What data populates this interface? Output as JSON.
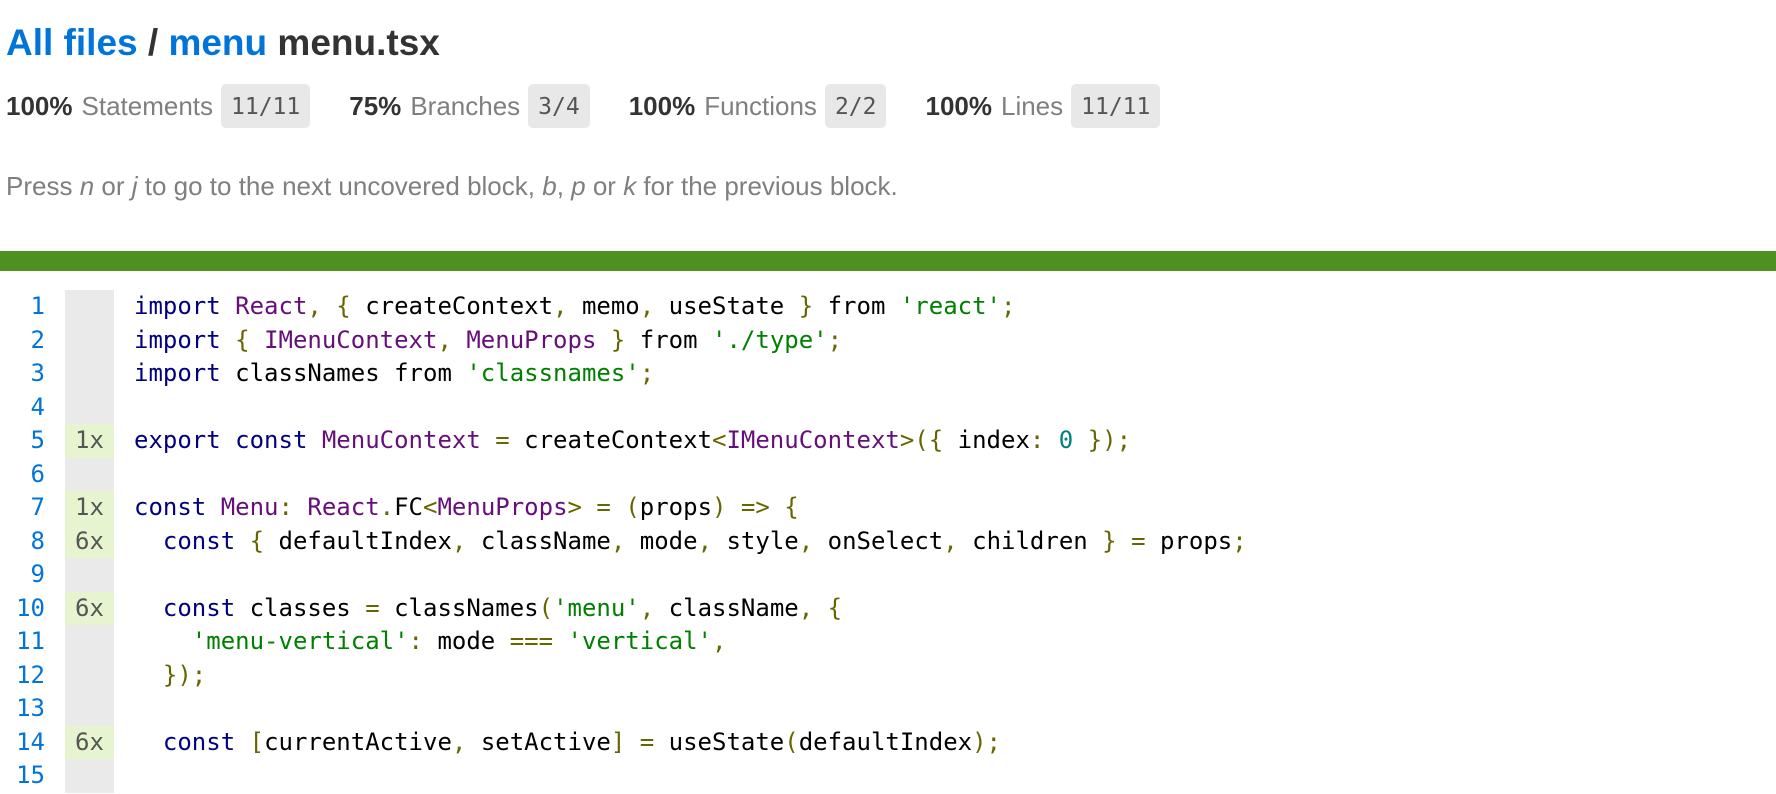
{
  "breadcrumb": {
    "all_files": "All files",
    "separator": "/",
    "folder": "menu",
    "file": "menu.tsx"
  },
  "stats": [
    {
      "pct": "100%",
      "name": "Statements",
      "fraction": "11/11"
    },
    {
      "pct": "75%",
      "name": "Branches",
      "fraction": "3/4"
    },
    {
      "pct": "100%",
      "name": "Functions",
      "fraction": "2/2"
    },
    {
      "pct": "100%",
      "name": "Lines",
      "fraction": "11/11"
    }
  ],
  "hint": {
    "t1": "Press ",
    "k1": "n",
    "t2": " or ",
    "k2": "j",
    "t3": " to go to the next uncovered block, ",
    "k3": "b",
    "t4": ", ",
    "k4": "p",
    "t5": " or ",
    "k5": "k",
    "t6": " for the previous block."
  },
  "colors": {
    "link": "#0074d9",
    "status_bar": "#4d9221",
    "hit_count_bg": "#e6f5d0",
    "gutter_bg": "#eaeaea"
  },
  "code_lines": [
    {
      "num": "1",
      "count": "",
      "tokens": [
        [
          "kw",
          "import "
        ],
        [
          "cls",
          "React"
        ],
        [
          "pn",
          ", { "
        ],
        [
          "",
          "createContext"
        ],
        [
          "pn",
          ", "
        ],
        [
          "",
          "memo"
        ],
        [
          "pn",
          ", "
        ],
        [
          "",
          "useState"
        ],
        [
          "pn",
          " } "
        ],
        [
          "",
          "from "
        ],
        [
          "str",
          "'react'"
        ],
        [
          "pn",
          ";"
        ]
      ]
    },
    {
      "num": "2",
      "count": "",
      "tokens": [
        [
          "kw",
          "import "
        ],
        [
          "pn",
          "{ "
        ],
        [
          "cls",
          "IMenuContext"
        ],
        [
          "pn",
          ", "
        ],
        [
          "cls",
          "MenuProps"
        ],
        [
          "pn",
          " } "
        ],
        [
          "",
          "from "
        ],
        [
          "str",
          "'./type'"
        ],
        [
          "pn",
          ";"
        ]
      ]
    },
    {
      "num": "3",
      "count": "",
      "tokens": [
        [
          "kw",
          "import "
        ],
        [
          "",
          "classNames "
        ],
        [
          "",
          "from "
        ],
        [
          "str",
          "'classnames'"
        ],
        [
          "pn",
          ";"
        ]
      ]
    },
    {
      "num": "4",
      "count": "",
      "tokens": []
    },
    {
      "num": "5",
      "count": "1x",
      "tokens": [
        [
          "kw",
          "export const "
        ],
        [
          "cls",
          "MenuContext"
        ],
        [
          "pn",
          " = "
        ],
        [
          "",
          "createContext"
        ],
        [
          "pn",
          "<"
        ],
        [
          "cls",
          "IMenuContext"
        ],
        [
          "pn",
          ">({ "
        ],
        [
          "",
          "index"
        ],
        [
          "pn",
          ": "
        ],
        [
          "num",
          "0"
        ],
        [
          "pn",
          " });"
        ]
      ]
    },
    {
      "num": "6",
      "count": "",
      "tokens": []
    },
    {
      "num": "7",
      "count": "1x",
      "tokens": [
        [
          "kw",
          "const "
        ],
        [
          "cls",
          "Menu"
        ],
        [
          "pn",
          ": "
        ],
        [
          "cls",
          "React"
        ],
        [
          "pn",
          "."
        ],
        [
          "",
          "FC"
        ],
        [
          "pn",
          "<"
        ],
        [
          "cls",
          "MenuProps"
        ],
        [
          "pn",
          "> = ("
        ],
        [
          "",
          "props"
        ],
        [
          "pn",
          ") => {"
        ]
      ]
    },
    {
      "num": "8",
      "count": "6x",
      "tokens": [
        [
          "",
          "  "
        ],
        [
          "kw",
          "const "
        ],
        [
          "pn",
          "{ "
        ],
        [
          "",
          "defaultIndex"
        ],
        [
          "pn",
          ", "
        ],
        [
          "",
          "className"
        ],
        [
          "pn",
          ", "
        ],
        [
          "",
          "mode"
        ],
        [
          "pn",
          ", "
        ],
        [
          "",
          "style"
        ],
        [
          "pn",
          ", "
        ],
        [
          "",
          "onSelect"
        ],
        [
          "pn",
          ", "
        ],
        [
          "",
          "children"
        ],
        [
          "pn",
          " } = "
        ],
        [
          "",
          "props"
        ],
        [
          "pn",
          ";"
        ]
      ]
    },
    {
      "num": "9",
      "count": "",
      "tokens": []
    },
    {
      "num": "10",
      "count": "6x",
      "tokens": [
        [
          "",
          "  "
        ],
        [
          "kw",
          "const "
        ],
        [
          "",
          "classes "
        ],
        [
          "pn",
          "= "
        ],
        [
          "",
          "classNames"
        ],
        [
          "pn",
          "("
        ],
        [
          "str",
          "'menu'"
        ],
        [
          "pn",
          ", "
        ],
        [
          "",
          "className"
        ],
        [
          "pn",
          ", {"
        ]
      ]
    },
    {
      "num": "11",
      "count": "",
      "tokens": [
        [
          "",
          "    "
        ],
        [
          "str",
          "'menu-vertical'"
        ],
        [
          "pn",
          ": "
        ],
        [
          "",
          "mode "
        ],
        [
          "pn",
          "=== "
        ],
        [
          "str",
          "'vertical'"
        ],
        [
          "pn",
          ","
        ]
      ]
    },
    {
      "num": "12",
      "count": "",
      "tokens": [
        [
          "",
          "  "
        ],
        [
          "pn",
          "});"
        ]
      ]
    },
    {
      "num": "13",
      "count": "",
      "tokens": []
    },
    {
      "num": "14",
      "count": "6x",
      "tokens": [
        [
          "",
          "  "
        ],
        [
          "kw",
          "const "
        ],
        [
          "pn",
          "["
        ],
        [
          "",
          "currentActive"
        ],
        [
          "pn",
          ", "
        ],
        [
          "",
          "setActive"
        ],
        [
          "pn",
          "] = "
        ],
        [
          "",
          "useState"
        ],
        [
          "pn",
          "("
        ],
        [
          "",
          "defaultIndex"
        ],
        [
          "pn",
          ");"
        ]
      ]
    },
    {
      "num": "15",
      "count": "",
      "tokens": []
    }
  ]
}
